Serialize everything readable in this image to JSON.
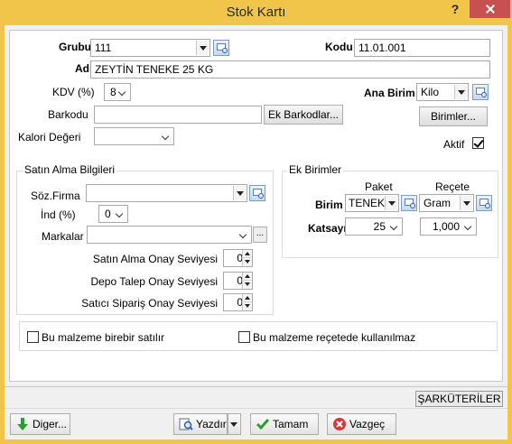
{
  "window": {
    "title": "Stok Kartı",
    "help": "?"
  },
  "form": {
    "grubu": {
      "label": "Grubu",
      "value": "111"
    },
    "kodu": {
      "label": "Kodu",
      "value": "11.01.001"
    },
    "adi": {
      "label": "Adı",
      "value": "ZEYTİN TENEKE 25 KG"
    },
    "kdv": {
      "label": "KDV (%)",
      "value": "8"
    },
    "ana_birim": {
      "label": "Ana Birim",
      "value": "Kilo"
    },
    "barkodu": {
      "label": "Barkodu",
      "value": ""
    },
    "ek_barkodlar_button": "Ek Barkodlar...",
    "birimler_button": "Birimler...",
    "kalori": {
      "label": "Kalori Değeri",
      "value": ""
    },
    "aktif": {
      "label": "Aktif",
      "checked": true
    }
  },
  "satin_alma": {
    "title": "Satın Alma Bilgileri",
    "soz_firma": {
      "label": "Söz.Firma",
      "value": ""
    },
    "ind": {
      "label": "İnd (%)",
      "value": "0"
    },
    "markalar": {
      "label": "Markalar",
      "value": ""
    },
    "onay_seviyesi": {
      "label": "Satın Alma Onay Seviyesi",
      "value": "0"
    },
    "depo_talep": {
      "label": "Depo Talep Onay Seviyesi",
      "value": "0"
    },
    "satici_siparis": {
      "label": "Satıcı Sipariş Onay Seviyesi",
      "value": "0"
    }
  },
  "ek_birimler": {
    "title": "Ek Birimler",
    "col_paket": "Paket",
    "col_recete": "Reçete",
    "birim_label": "Birim",
    "paket_birim": "TENEK",
    "recete_birim": "Gram",
    "katsayi_label": "Katsayı",
    "paket_katsayi": "25",
    "recete_katsayi": "1,000"
  },
  "options": {
    "birebir": {
      "label": "Bu malzeme birebir satılır",
      "checked": false
    },
    "recete": {
      "label": "Bu malzeme reçetede kullanılmaz",
      "checked": false
    }
  },
  "status": {
    "company": "ŞARKÜTERİLER"
  },
  "toolbar": {
    "diger": "Diger...",
    "yazdir": "Yazdır",
    "tamam": "Tamam",
    "vazgec": "Vazgeç"
  },
  "colors": {
    "title_bar": "#f1c44a",
    "close_button": "#c75050",
    "ok_green": "#2e9b2e",
    "cancel_red": "#d23a3a"
  }
}
